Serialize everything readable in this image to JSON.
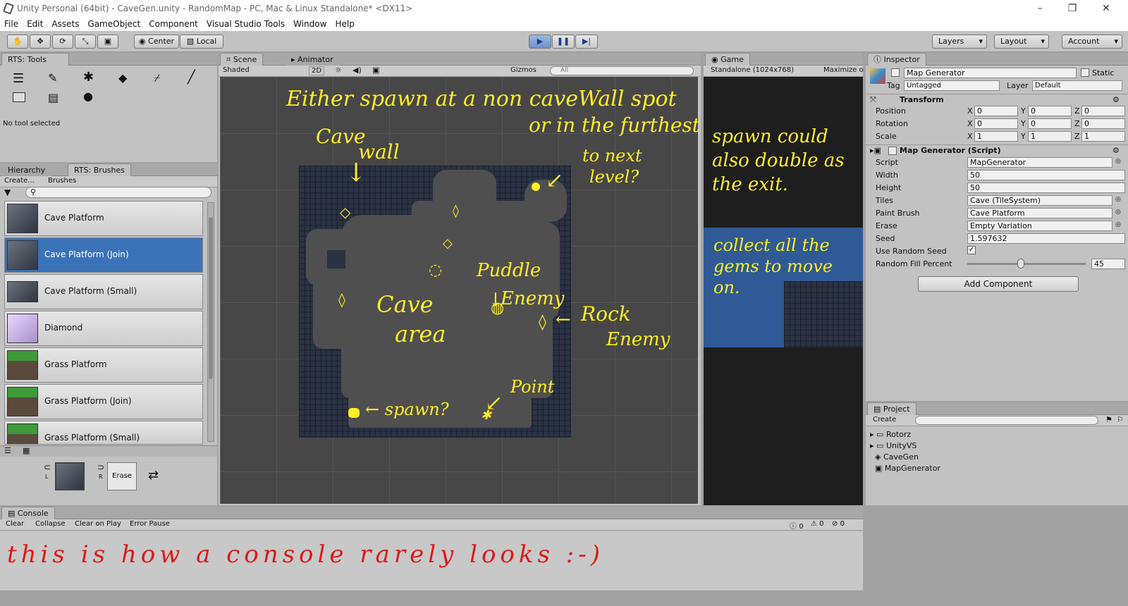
{
  "window": {
    "title": "Unity Personal (64bit) - CaveGen.unity - RandomMap - PC, Mac & Linux Standalone* <DX11>",
    "controls": [
      "–",
      "❐",
      "✕"
    ]
  },
  "menu": [
    "File",
    "Edit",
    "Assets",
    "GameObject",
    "Component",
    "Visual Studio Tools",
    "Window",
    "Help"
  ],
  "toolbar": {
    "pivot": "Center",
    "space": "Local",
    "layers": "Layers",
    "layout": "Layout",
    "account": "Account"
  },
  "rts_tools": {
    "tab": "RTS: Tools",
    "status": "No tool selected"
  },
  "brushes_panel": {
    "tabs": [
      "Hierarchy",
      "RTS: Brushes"
    ],
    "create": "Create...",
    "brushes_dropdown": "Brushes",
    "search_placeholder": "",
    "items": [
      {
        "label": "Cave Platform"
      },
      {
        "label": "Cave Platform (Join)"
      },
      {
        "label": "Cave Platform (Small)"
      },
      {
        "label": "Diamond"
      },
      {
        "label": "Grass Platform"
      },
      {
        "label": "Grass Platform (Join)"
      },
      {
        "label": "Grass Platform (Small)"
      }
    ],
    "erase": "Erase",
    "left_label": "L",
    "right_label": "R"
  },
  "scene": {
    "tabs": [
      "Scene",
      "Animator"
    ],
    "shading": "Shaded",
    "mode2d": "2D",
    "gizmos": "Gizmos",
    "search_placeholder": "All",
    "annotations": {
      "a1": "Either spawn at a non caveWall spot",
      "a2": "or in the furthest corner.",
      "a3": "Cave",
      "a4": "wall",
      "a5": "to next",
      "a6": "level?",
      "a7": "Puddle",
      "a8": "Enemy",
      "a9": "Cave",
      "a10": "area",
      "a11": "Rock",
      "a12": "Enemy",
      "a13": "spawn?",
      "a14": "Point"
    }
  },
  "game": {
    "tab": "Game",
    "resolution": "Standalone (1024x768)",
    "maximize": "Maximize o",
    "note1": "spawn could also double as the exit.",
    "note2": "collect all the gems to move on."
  },
  "inspector": {
    "tab": "Inspector",
    "object_name": "Map Generator",
    "static": "Static",
    "tag_label": "Tag",
    "tag": "Untagged",
    "layer_label": "Layer",
    "layer": "Default",
    "transform": {
      "title": "Transform",
      "rows": [
        {
          "label": "Position",
          "x": "0",
          "y": "0",
          "z": "0"
        },
        {
          "label": "Rotation",
          "x": "0",
          "y": "0",
          "z": "0"
        },
        {
          "label": "Scale",
          "x": "1",
          "y": "1",
          "z": "1"
        }
      ]
    },
    "script_component": {
      "title": "Map Generator (Script)",
      "fields": [
        {
          "label": "Script",
          "value": "MapGenerator"
        },
        {
          "label": "Width",
          "value": "50"
        },
        {
          "label": "Height",
          "value": "50"
        },
        {
          "label": "Tiles",
          "value": "Cave (TileSystem)"
        },
        {
          "label": "Paint Brush",
          "value": "Cave Platform"
        },
        {
          "label": "Erase",
          "value": "Empty Variation"
        },
        {
          "label": "Seed",
          "value": "1.597632"
        }
      ],
      "use_random_seed": "Use Random Seed",
      "random_fill_label": "Random Fill Percent",
      "random_fill_value": "45",
      "random_fill_fraction": 0.45
    },
    "add_component": "Add Component"
  },
  "project": {
    "tab": "Project",
    "create": "Create",
    "items": [
      "Rotorz",
      "UnityVS",
      "CaveGen",
      "MapGenerator"
    ]
  },
  "console": {
    "tab": "Console",
    "buttons": [
      "Clear",
      "Collapse",
      "Clear on Play",
      "Error Pause"
    ],
    "counts": [
      "0",
      "0",
      "0"
    ],
    "note": "this is how a console rarely looks :-)"
  }
}
